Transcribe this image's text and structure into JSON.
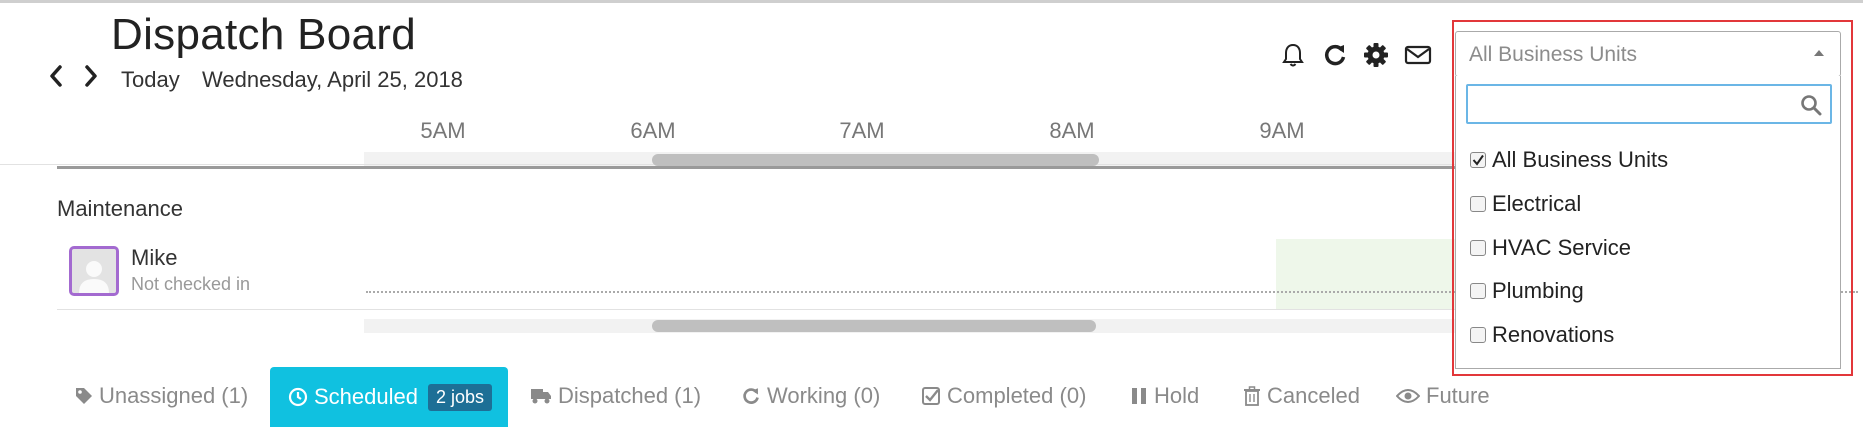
{
  "header": {
    "title": "Dispatch Board",
    "today_label": "Today",
    "date": "Wednesday, April 25, 2018"
  },
  "toolbar": {
    "icons": [
      "bell-icon",
      "refresh-icon",
      "gear-icon",
      "envelope-icon"
    ]
  },
  "timeline": {
    "hours": [
      "5AM",
      "6AM",
      "7AM",
      "8AM",
      "9AM"
    ]
  },
  "board": {
    "group": "Maintenance",
    "technician": {
      "name": "Mike",
      "status": "Not checked in"
    }
  },
  "business_units": {
    "selected": "All Business Units",
    "search_value": "",
    "options": [
      {
        "label": "All Business Units",
        "checked": true
      },
      {
        "label": "Electrical",
        "checked": false
      },
      {
        "label": "HVAC Service",
        "checked": false
      },
      {
        "label": "Plumbing",
        "checked": false
      },
      {
        "label": "Renovations",
        "checked": false
      }
    ]
  },
  "tabs": [
    {
      "label": "Unassigned (1)",
      "icon": "tag-icon"
    },
    {
      "label": "Scheduled",
      "badge": "2 jobs",
      "icon": "clock-icon",
      "active": true
    },
    {
      "label": "Dispatched (1)",
      "icon": "truck-icon"
    },
    {
      "label": "Working (0)",
      "icon": "refresh-icon"
    },
    {
      "label": "Completed (0)",
      "icon": "check-square-icon"
    },
    {
      "label": "Hold",
      "icon": "pause-icon"
    },
    {
      "label": "Canceled",
      "icon": "trash-icon"
    },
    {
      "label": "Future",
      "icon": "eye-icon"
    }
  ],
  "colors": {
    "active_tab": "#10c1e0",
    "badge": "#1d6f96",
    "avatar_border": "#a36ad0",
    "highlight": "#e2373a"
  }
}
